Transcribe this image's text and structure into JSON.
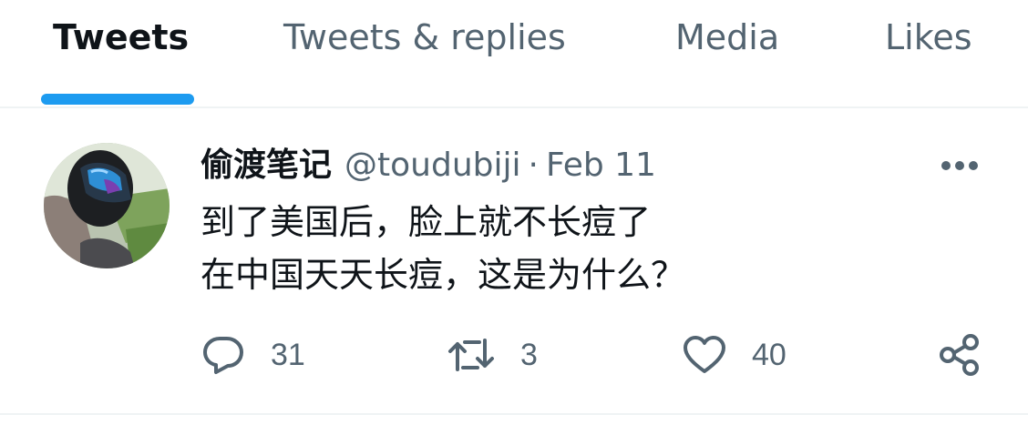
{
  "tabs": [
    {
      "label": "Tweets",
      "active": true
    },
    {
      "label": "Tweets & replies",
      "active": false
    },
    {
      "label": "Media",
      "active": false
    },
    {
      "label": "Likes",
      "active": false
    }
  ],
  "tweet": {
    "display_name": "偷渡笔记",
    "handle": "@toudubiji",
    "separator": "·",
    "date": "Feb 11",
    "text_lines": [
      "到了美国后，脸上就不长痘了",
      "在中国天天长痘，这是为什么？"
    ],
    "actions": {
      "reply_count": "31",
      "retweet_count": "3",
      "like_count": "40"
    }
  },
  "icons": {
    "more": "more-horizontal-icon",
    "reply": "reply-bubble-icon",
    "retweet": "retweet-icon",
    "like": "heart-icon",
    "share": "share-icon"
  },
  "colors": {
    "accent": "#1d9bf0",
    "primary_text": "#0f1419",
    "secondary_text": "#536471",
    "divider": "#eff3f4"
  }
}
